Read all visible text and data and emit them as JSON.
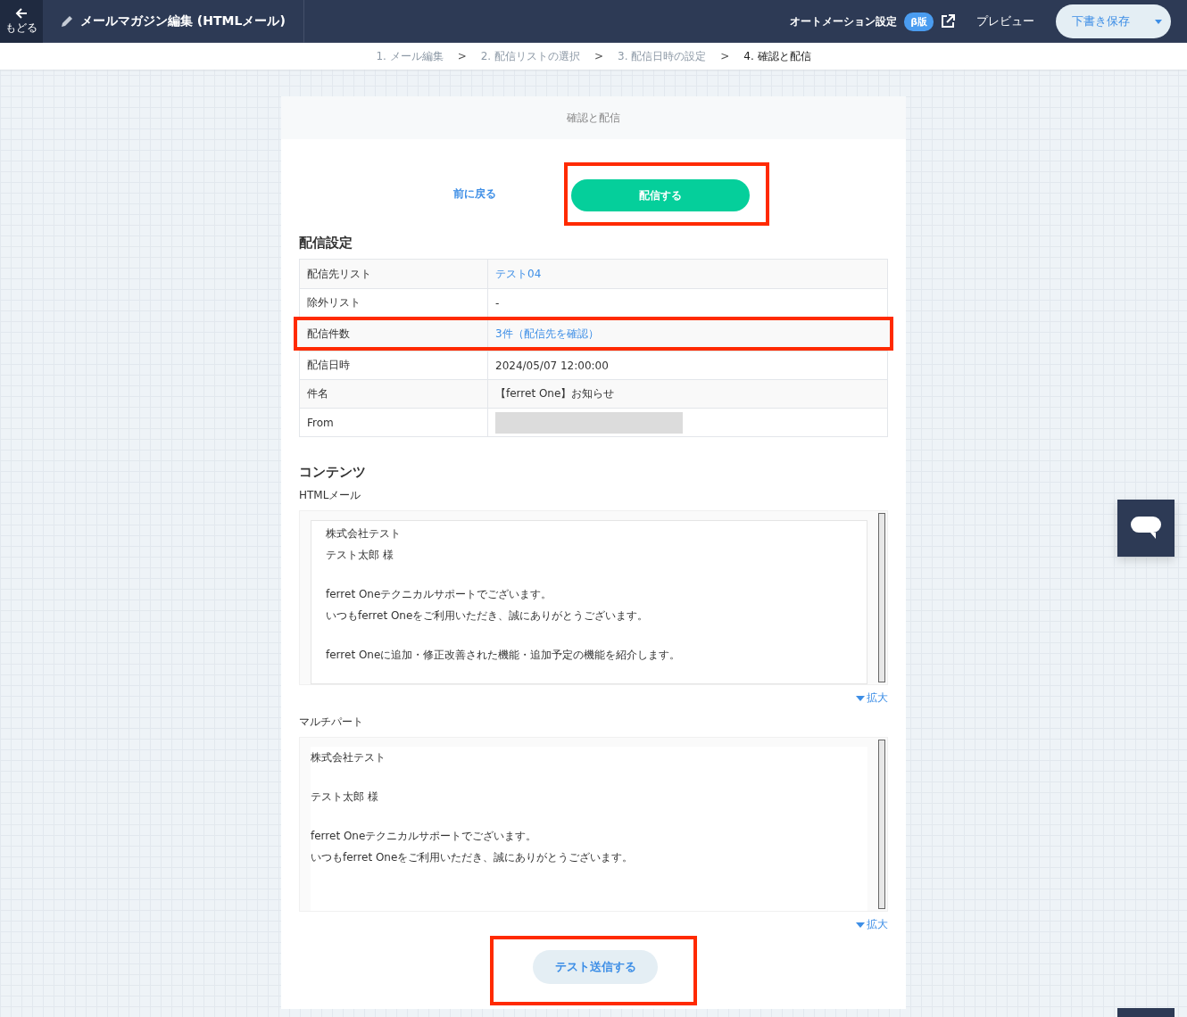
{
  "header": {
    "back_label": "もどる",
    "title": "メールマガジン編集 (HTMLメール)",
    "automation": "オートメーション設定",
    "beta_badge": "β版",
    "preview": "プレビュー",
    "save": "下書き保存"
  },
  "steps": [
    {
      "label": "1. メール編集",
      "selected": false
    },
    {
      "label": "2. 配信リストの選択",
      "selected": false
    },
    {
      "label": "3. 配信日時の設定",
      "selected": false
    },
    {
      "label": "4. 確認と配信",
      "selected": true
    }
  ],
  "step_separator": ">",
  "card": {
    "title": "確認と配信",
    "back_link": "前に戻る",
    "send_button": {
      "label": "配信する",
      "highlighted": true
    }
  },
  "settings": {
    "heading": "配信設定",
    "rows": [
      {
        "label": "配信先リスト",
        "value": "テスト04",
        "kind": "link",
        "highlighted": false
      },
      {
        "label": "除外リスト",
        "value": "-",
        "kind": "text",
        "highlighted": false
      },
      {
        "label": "配信件数",
        "value": "3件（配信先を確認）",
        "kind": "link",
        "highlighted": true
      },
      {
        "label": "配信日時",
        "value": "2024/05/07 12:00:00",
        "kind": "text",
        "highlighted": false
      },
      {
        "label": "件名",
        "value": "【ferret One】お知らせ",
        "kind": "text",
        "highlighted": false
      },
      {
        "label": "From",
        "kind": "redacted",
        "highlighted": false
      }
    ]
  },
  "contents": {
    "heading": "コンテンツ",
    "previews": [
      {
        "label": "HTMLメール",
        "kind": "html",
        "expand": "拡大",
        "paragraphs": [
          [
            "株式会社テスト",
            "テスト太郎 様"
          ],
          [
            "ferret Oneテクニカルサポートでございます。",
            "いつもferret Oneをご利用いただき、誠にありがとうございます。"
          ],
          [
            "ferret Oneに追加・修正改善された機能・追加予定の機能を紹介します。"
          ]
        ]
      },
      {
        "label": "マルチパート",
        "kind": "text",
        "expand": "拡大",
        "paragraphs": [
          [
            "株式会社テスト"
          ],
          [
            "テスト太郎 様"
          ],
          [
            "ferret Oneテクニカルサポートでございます。",
            "いつもferret Oneをご利用いただき、誠にありがとうございます。"
          ]
        ]
      }
    ]
  },
  "test_send": {
    "label": "テスト送信する",
    "highlighted": true
  }
}
